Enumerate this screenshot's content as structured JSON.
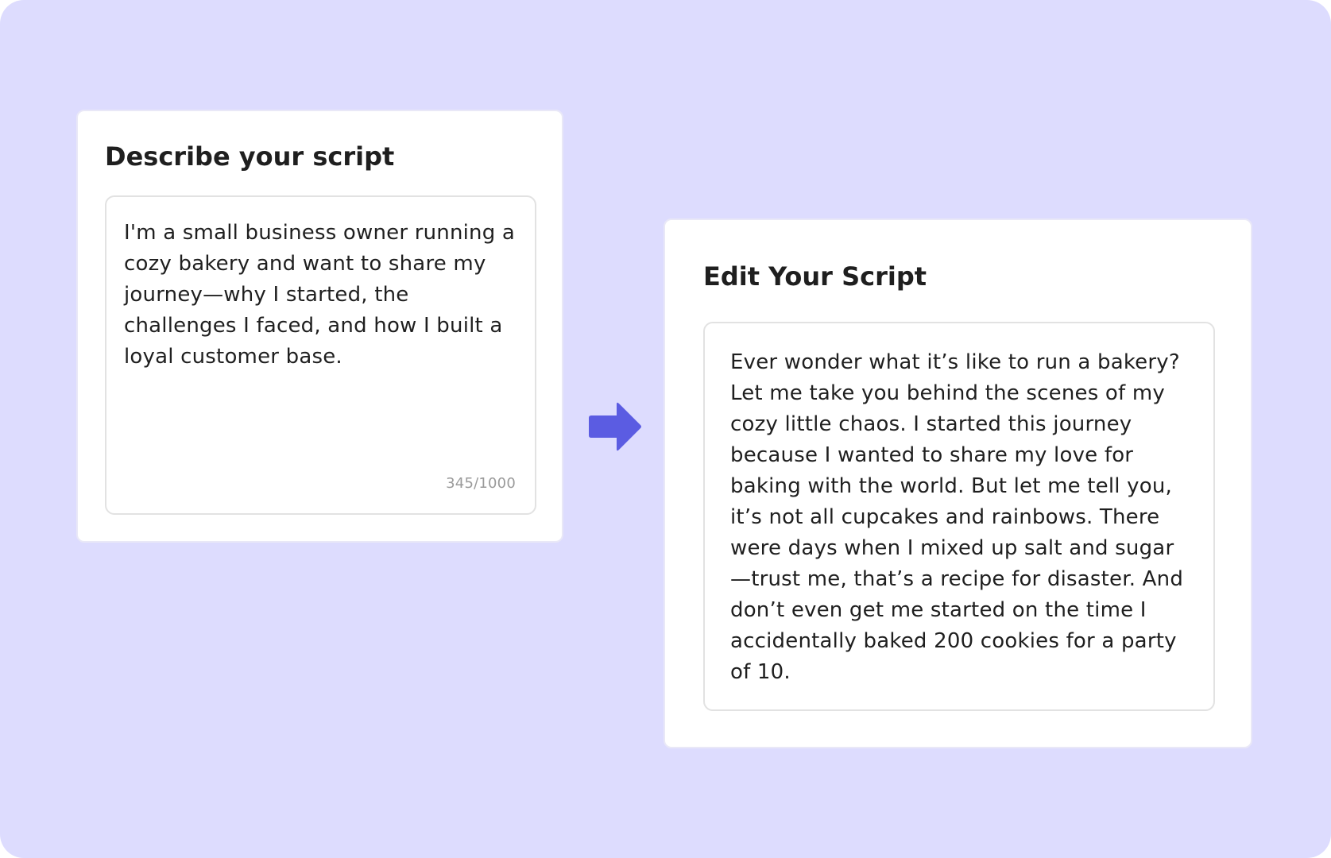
{
  "describe_card": {
    "title": "Describe your script",
    "text": "I'm a small business owner running a cozy bakery and want to share my journey—why I started, the challenges I faced, and how I built a loyal customer base.",
    "counter": "345/1000"
  },
  "edit_card": {
    "title": "Edit Your Script",
    "text": "Ever wonder what it’s like to run a bakery? Let me take you behind the scenes of my cozy little chaos. I started this journey because I wanted to share my love for baking with the world. But let me tell you, it’s not all cupcakes and rainbows. There were days when I mixed up salt and sugar —trust me, that’s a recipe for disaster. And don’t even get me started on the time I accidentally baked 200 cookies for a party of 10."
  },
  "icons": {
    "arrow": "arrow-right-icon"
  },
  "colors": {
    "background": "#dddcfe",
    "accent": "#5b5ce2",
    "card": "#ffffff",
    "text": "#1f1f1f",
    "muted": "#9a9a9a"
  }
}
